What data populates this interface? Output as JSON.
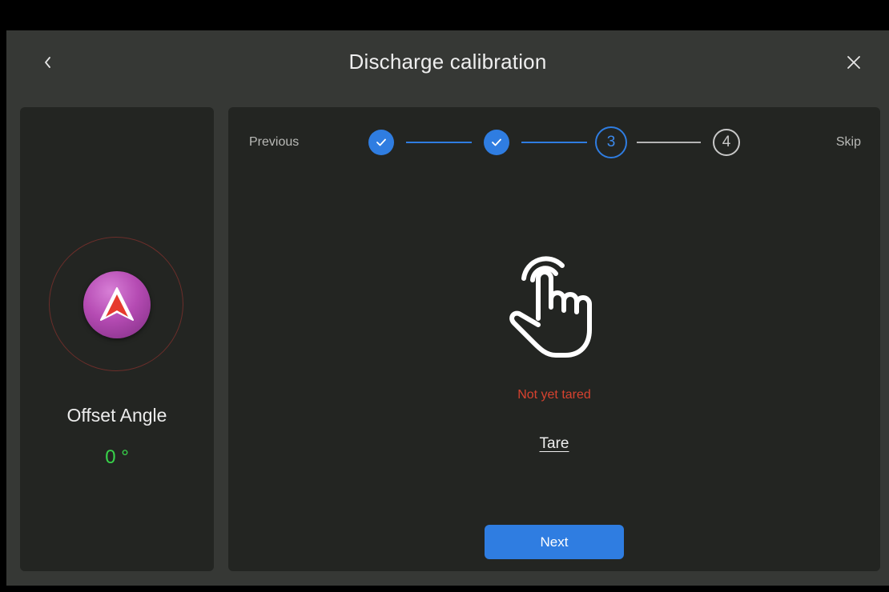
{
  "header": {
    "title": "Discharge calibration",
    "back_icon": "chevron-left-icon",
    "close_icon": "close-icon"
  },
  "left_panel": {
    "compass_icon": "navigation-arrow-icon",
    "offset_label": "Offset Angle",
    "offset_value": "0 °",
    "offset_value_color": "#38d44a"
  },
  "stepper": {
    "previous_label": "Previous",
    "skip_label": "Skip",
    "steps": [
      {
        "label": "",
        "state": "completed",
        "icon": "check-icon"
      },
      {
        "label": "",
        "state": "completed",
        "icon": "check-icon"
      },
      {
        "label": "3",
        "state": "current"
      },
      {
        "label": "4",
        "state": "pending"
      }
    ],
    "accent_color": "#2f7de1"
  },
  "main": {
    "illustration_icon": "tap-hand-icon",
    "status_text": "Not yet tared",
    "status_color": "#d7422f",
    "tare_label": "Tare",
    "next_label": "Next"
  }
}
